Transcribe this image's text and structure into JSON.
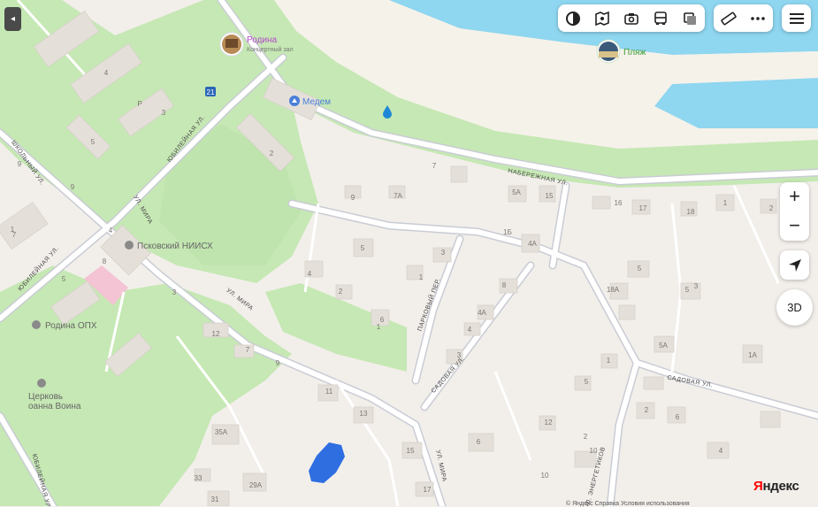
{
  "map": {
    "streets": [
      "НАБЕРЕЖНАЯ УЛ.",
      "ЮБИЛЕЙНАЯ УЛ.",
      "ЮБИЛЕЙНАЯ УЛ.",
      "ШКОЛЬНЫЙ УЛ.",
      "УЛ. МИРА",
      "УЛ. МИРА",
      "УЛ. МИРА",
      "ПАРКОВЫЙ ПЕР.",
      "САДОВАЯ УЛ.",
      "САДОВАЯ УЛ.",
      "УЛ. ЭНЕРГЕТИКОВ",
      "ЮБИЛЕЙНАЯ УЛ."
    ],
    "pois": [
      {
        "name": "Родина",
        "subtitle": "Концертный зал",
        "icon": "concert-hall-photo",
        "color": "#b14ac9"
      },
      {
        "name": "Пляж",
        "icon": "beach-photo",
        "color": "#3a9a2f"
      },
      {
        "name": "Медем",
        "icon": "hospital-icon",
        "color": "#4a7fd9"
      },
      {
        "name": "Псковский НИИСХ",
        "icon": "institute-icon",
        "color": "#666666"
      },
      {
        "name": "Родина ОПХ",
        "icon": "place-icon",
        "color": "#666666"
      },
      {
        "name": "Церковь\nоанна Воина",
        "icon": "church-icon",
        "color": "#666666"
      }
    ],
    "house_numbers": [
      "4",
      "3",
      "5",
      "2",
      "7",
      "9",
      "9",
      "7",
      "7А",
      "5А",
      "15",
      "16",
      "17",
      "18",
      "1",
      "2",
      "5",
      "3",
      "4А",
      "4",
      "2",
      "1",
      "6",
      "8",
      "5",
      "3",
      "1Б",
      "18А",
      "5",
      "4А",
      "4",
      "3",
      "1",
      "5А",
      "1А",
      "5",
      "2",
      "6",
      "4",
      "1",
      "11",
      "13",
      "12",
      "15",
      "10",
      "35А",
      "33",
      "29А",
      "31",
      "17",
      "10",
      "6",
      "9",
      "Р",
      "4",
      "3",
      "7",
      "12",
      "9",
      "8",
      "5",
      "1",
      "2"
    ],
    "route_badge": "21",
    "colors": {
      "water": "#8fd6f0",
      "park": "#c6e8b4",
      "sand": "#f5f1e8",
      "road": "#ffffff",
      "road_casing": "#c9ccd3",
      "block": "#f2efeb",
      "building": "#e4e0d9",
      "accent_blue": "#1a5fe0",
      "hospital_pink": "#f4c3d4"
    }
  },
  "ui": {
    "back_icon": "◂",
    "toolbar_icons": [
      "layers-icon",
      "panorama-icon",
      "camera-icon",
      "bus-icon",
      "traffic-icon"
    ],
    "tool_icons": [
      "ruler-icon",
      "more-icon"
    ],
    "menu_icon": "menu-icon",
    "zoom_in": "+",
    "zoom_out": "−",
    "locate_icon": "locate-icon",
    "view3d": "3D",
    "logo_y": "Я",
    "logo_rest": "ндекс",
    "copyright": "© Яндекс Справка Условия использования"
  }
}
